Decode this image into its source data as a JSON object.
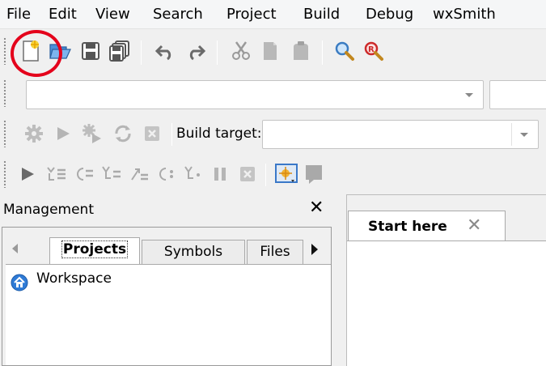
{
  "menu": [
    "File",
    "Edit",
    "View",
    "Search",
    "Project",
    "Build",
    "Debug",
    "wxSmith"
  ],
  "main_toolbar": {
    "icons": [
      "new-file-icon",
      "open-folder-icon",
      "save-icon",
      "save-all-icon",
      "undo-icon",
      "redo-icon",
      "cut-icon",
      "copy-icon",
      "paste-icon",
      "find-icon",
      "replace-icon"
    ]
  },
  "search_toolbar": {
    "combo_value": "",
    "combo2_value": ""
  },
  "compiler_toolbar": {
    "icons": [
      "build-gear-icon",
      "run-icon",
      "build-and-run-icon",
      "rebuild-icon",
      "abort-icon"
    ],
    "build_target_label": "Build target:",
    "build_target_value": ""
  },
  "debugger_toolbar": {
    "icons": [
      "debug-run-icon",
      "run-to-cursor-icon",
      "next-line-icon",
      "step-into-icon",
      "step-out-icon",
      "next-instruction-icon",
      "step-into-instruction-icon",
      "break-debugger-icon",
      "stop-debugger-icon",
      "debug-windows-icon",
      "debug-info-icon"
    ]
  },
  "management": {
    "title": "Management",
    "close": "✕",
    "tabs": [
      "Projects",
      "Symbols",
      "Files"
    ],
    "active_tab": "Projects",
    "tree": [
      {
        "label": "Workspace",
        "icon": "workspace-icon"
      }
    ]
  },
  "editor": {
    "tabs": [
      {
        "label": "Start here",
        "close": "✕"
      }
    ]
  },
  "colors": {
    "highlight": "#e4001b",
    "disabled_icon": "#b8b8b8",
    "accent_blue": "#3a78c8"
  }
}
